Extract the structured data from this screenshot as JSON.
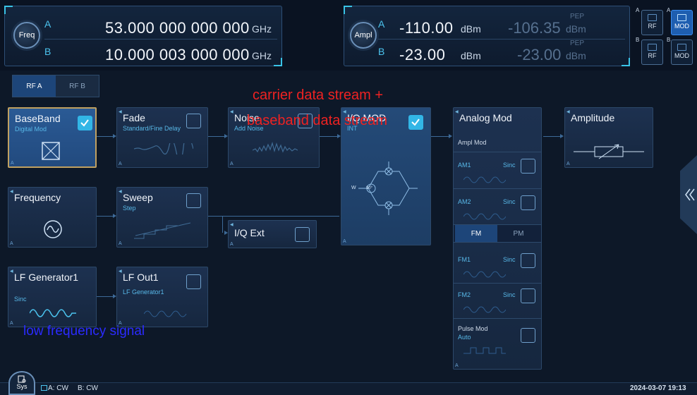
{
  "freq_panel": {
    "knob_label": "Freq",
    "a_label": "A",
    "b_label": "B",
    "a_value": "53.000 000 000 000",
    "a_unit": "GHz",
    "b_value": "10.000 003 000 000",
    "b_unit": "GHz"
  },
  "ampl_panel": {
    "knob_label": "Ampl",
    "a_label": "A",
    "b_label": "B",
    "a_value": "-110.00",
    "a_unit": "dBm",
    "a_pep_value": "-106.35",
    "a_pep_label": "PEP",
    "a_pep_unit": "dBm",
    "b_value": "-23.00",
    "b_unit": "dBm",
    "b_pep_value": "-23.00",
    "b_pep_label": "PEP",
    "b_pep_unit": "dBm"
  },
  "mode_buttons": [
    {
      "corner": "A",
      "label": "RF",
      "active": false
    },
    {
      "corner": "A",
      "label": "MOD",
      "active": true
    },
    {
      "corner": "B",
      "label": "RF",
      "active": false
    },
    {
      "corner": "B",
      "label": "MOD",
      "active": false
    }
  ],
  "tabs": [
    {
      "label": "RF A",
      "active": true
    },
    {
      "label": "RF B",
      "active": false
    }
  ],
  "blocks": {
    "baseband": {
      "title": "BaseBand",
      "sub": "Digital Mod"
    },
    "fade": {
      "title": "Fade",
      "sub": "Standard/Fine Delay"
    },
    "noise": {
      "title": "Noise",
      "sub": "Add Noise"
    },
    "iq_mod": {
      "title": "I/Q MOD",
      "sub": "INT",
      "w_label": "W",
      "phase": "90°"
    },
    "analog_mod": {
      "title": "Analog Mod"
    },
    "amplitude": {
      "title": "Amplitude"
    },
    "frequency": {
      "title": "Frequency"
    },
    "sweep": {
      "title": "Sweep",
      "sub": "Step"
    },
    "iq_ext": {
      "title": "I/Q Ext"
    },
    "lf_generator": {
      "title": "LF Generator1",
      "sub": "Sinc"
    },
    "lf_out": {
      "title": "LF Out1",
      "sub": "LF Generator1"
    }
  },
  "analog_mod": {
    "ampl_mod": "Ampl Mod",
    "am1": {
      "label": "AM1",
      "value": "Sinc"
    },
    "am2": {
      "label": "AM2",
      "value": "Sinc"
    },
    "fm_tabs": [
      {
        "label": "FM",
        "active": true
      },
      {
        "label": "PM",
        "active": false
      }
    ],
    "fm1": {
      "label": "FM1",
      "value": "Sinc"
    },
    "fm2": {
      "label": "FM2",
      "value": "Sinc"
    },
    "pulse": {
      "label": "Pulse Mod",
      "value": "Auto"
    }
  },
  "annotations": {
    "carrier_line1": "carrier data stream +",
    "carrier_line2": "baseband data stream",
    "lf_signal": "low frequency signal"
  },
  "status_bar": {
    "sys_label": "Sys",
    "channel_a": "A: CW",
    "channel_b": "B: CW",
    "datetime": "2024-03-07 19:13"
  },
  "colors": {
    "accent": "#32b6e6",
    "background": "#0c1626",
    "annotation_red": "#ee2222",
    "annotation_blue": "#2b2bff"
  }
}
